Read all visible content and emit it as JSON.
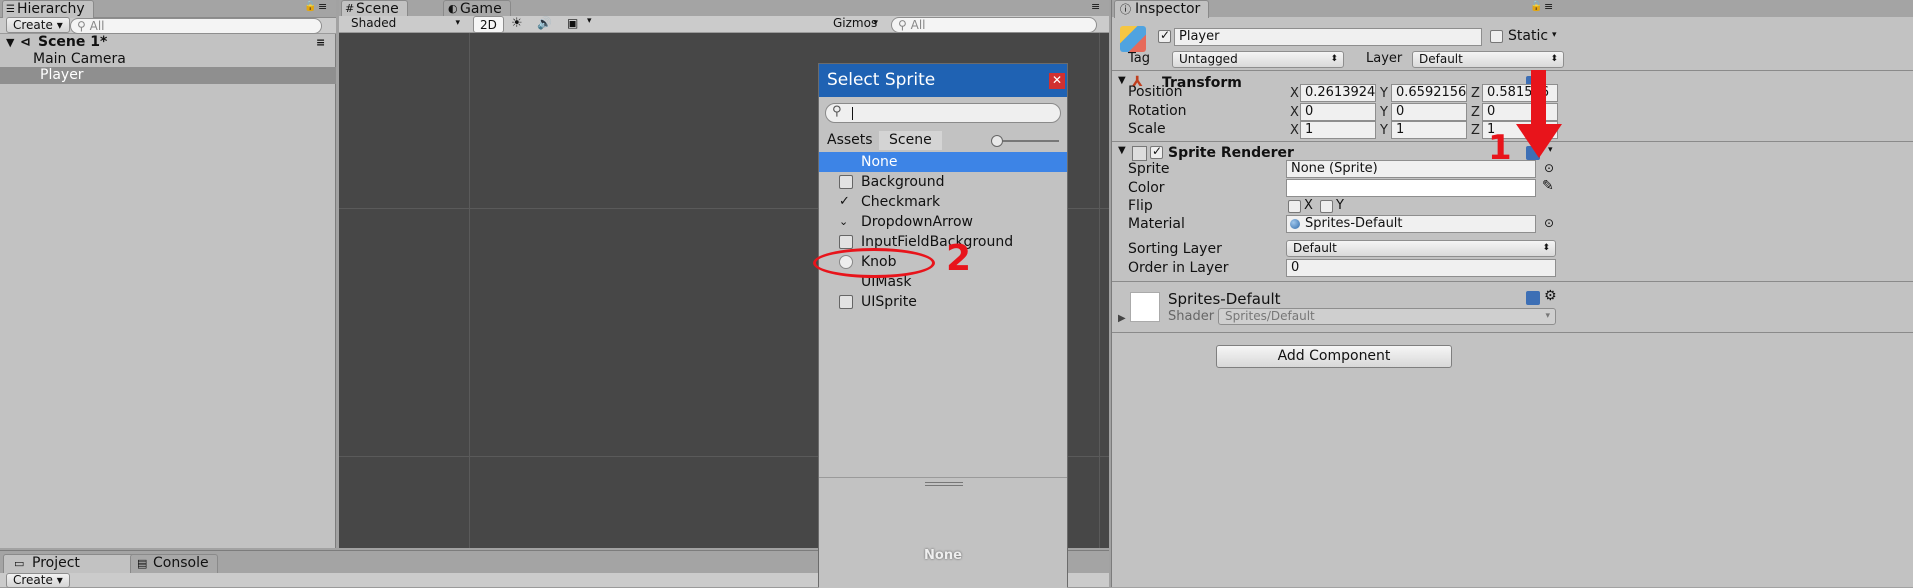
{
  "hierarchy": {
    "tab_label": "Hierarchy",
    "create_label": "Create ▾",
    "search_placeholder": "All",
    "scene_name": "Scene 1*",
    "items": [
      {
        "label": "Main Camera"
      },
      {
        "label": "Player"
      }
    ]
  },
  "scene_view": {
    "tab_scene": "Scene",
    "tab_game": "Game",
    "shading": "Shaded",
    "mode_2d": "2D",
    "gizmos": "Gizmos",
    "search_placeholder": "All"
  },
  "select_sprite": {
    "title": "Select Sprite",
    "search_value": "",
    "tab_assets": "Assets",
    "tab_scene": "Scene",
    "items": [
      {
        "label": "None",
        "icon": "none",
        "selected": true
      },
      {
        "label": "Background",
        "icon": "square-outline-icon"
      },
      {
        "label": "Checkmark",
        "icon": "checkmark-icon"
      },
      {
        "label": "DropdownArrow",
        "icon": "chevron-down-icon"
      },
      {
        "label": "InputFieldBackground",
        "icon": "square-outline-icon"
      },
      {
        "label": "Knob",
        "icon": "circle-icon"
      },
      {
        "label": "UIMask",
        "icon": "none"
      },
      {
        "label": "UISprite",
        "icon": "square-outline-icon"
      }
    ],
    "preview_label": "None"
  },
  "annotations": {
    "marker_1": "1",
    "marker_2": "2",
    "color": "#e8141b"
  },
  "inspector": {
    "tab_label": "Inspector",
    "object_name": "Player",
    "static_label": "Static",
    "tag_label": "Tag",
    "tag_value": "Untagged",
    "layer_label": "Layer",
    "layer_value": "Default",
    "transform": {
      "title": "Transform",
      "rows": [
        {
          "label": "Position",
          "x": "0.2613924",
          "y": "0.6592156",
          "z": "0.581516"
        },
        {
          "label": "Rotation",
          "x": "0",
          "y": "0",
          "z": "0"
        },
        {
          "label": "Scale",
          "x": "1",
          "y": "1",
          "z": "1"
        }
      ]
    },
    "sprite_renderer": {
      "title": "Sprite Renderer",
      "sprite_label": "Sprite",
      "sprite_value": "None (Sprite)",
      "color_label": "Color",
      "flip_label": "Flip",
      "flip_x": "X",
      "flip_y": "Y",
      "material_label": "Material",
      "material_value": "Sprites-Default",
      "sorting_layer_label": "Sorting Layer",
      "sorting_layer_value": "Default",
      "order_label": "Order in Layer",
      "order_value": "0"
    },
    "material_section": {
      "name": "Sprites-Default",
      "shader_label": "Shader",
      "shader_value": "Sprites/Default"
    },
    "add_component_label": "Add Component"
  },
  "bottom": {
    "tab_project": "Project",
    "tab_console": "Console",
    "create_label": "Create ▾"
  },
  "colors": {
    "selection_blue": "#3d84e6",
    "dialog_title_blue": "#1f62b3",
    "scene_bg": "#474747"
  }
}
